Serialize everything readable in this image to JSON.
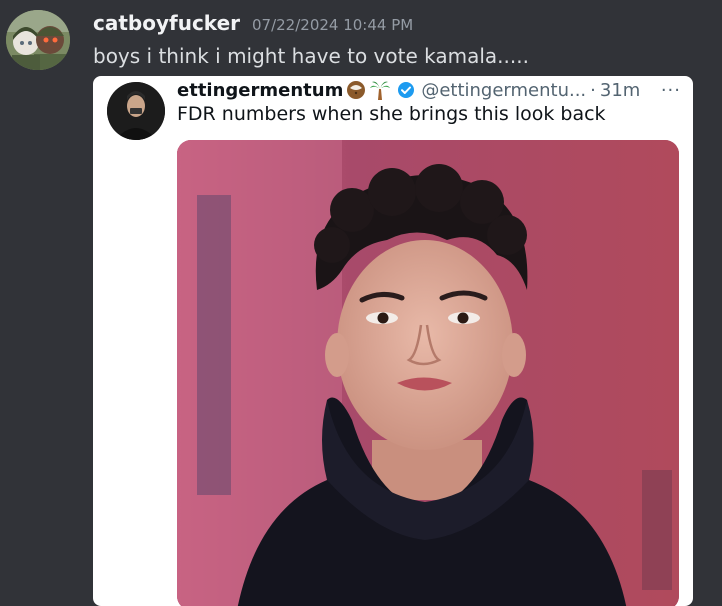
{
  "message": {
    "username": "catboyfucker",
    "timestamp": "07/22/2024 10:44 PM",
    "text": "boys i think i might have to vote kamala....."
  },
  "embed": {
    "display_name": "ettingermentum",
    "handle": "@ettingermentu...",
    "separator": "·",
    "time_ago": "31m",
    "more": "···",
    "text": "FDR numbers when she brings this look back",
    "emojis": [
      "coconut-emoji",
      "palm-tree-emoji"
    ],
    "verified_icon": "verified-badge-icon"
  },
  "colors": {
    "background": "#313338",
    "username": "#f2f3f5",
    "timestamp": "#949ba4",
    "message_text": "#dbdee1",
    "embed_bg": "#ffffff",
    "verified": "#1d9bf0"
  }
}
